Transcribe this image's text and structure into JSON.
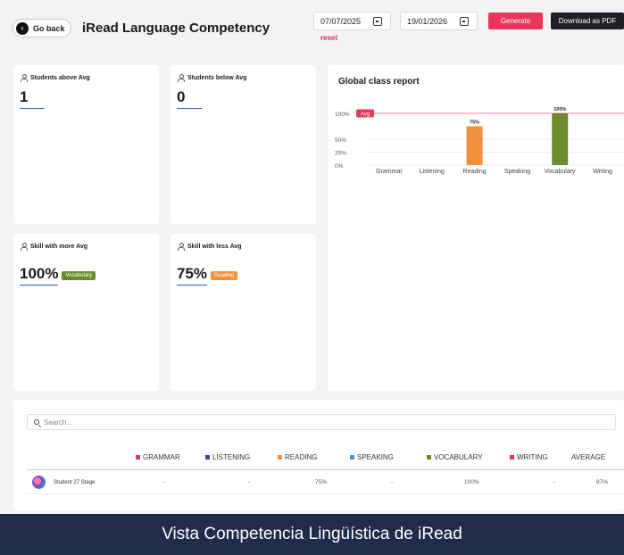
{
  "header": {
    "back_label": "Go back",
    "title": "iRead Language Competency",
    "date_from": "07/07/2025",
    "date_to": "19/01/2026",
    "reset": "reset",
    "generate": "Generate",
    "download": "Download as PDF"
  },
  "cards": {
    "above": {
      "label": "Students above Avg",
      "value": "1"
    },
    "below": {
      "label": "Students below Avg",
      "value": "0"
    },
    "more": {
      "label": "Skill with more Avg",
      "value": "100%",
      "badge": "Vocabulary",
      "color": "#6a8a2c"
    },
    "less": {
      "label": "Skill with less Avg",
      "value": "75%",
      "badge": "Reading",
      "color": "#f0903a"
    }
  },
  "chart": {
    "title": "Global class report",
    "avg_label": "Avg"
  },
  "chart_data": {
    "type": "bar",
    "categories": [
      "Grammar",
      "Listening",
      "Reading",
      "Speaking",
      "Vocabulary",
      "Writing"
    ],
    "values": [
      null,
      null,
      75,
      null,
      100,
      null
    ],
    "data_labels": [
      "",
      "",
      "75%",
      "",
      "100%",
      ""
    ],
    "colors": [
      "#c2407a",
      "#2c4f8f",
      "#f0903a",
      "#4f90d0",
      "#6a8a2c",
      "#d94040"
    ],
    "avg_line": 100,
    "ylim": [
      0,
      100
    ],
    "yticks": [
      {
        "v": 0,
        "label": "0%"
      },
      {
        "v": 25,
        "label": "25%"
      },
      {
        "v": 50,
        "label": "50%"
      },
      {
        "v": 100,
        "label": "100%"
      }
    ],
    "grid": true
  },
  "table": {
    "search_placeholder": "Search...",
    "columns": [
      {
        "label": "GRAMMAR",
        "color": "#c2407a"
      },
      {
        "label": "LISTENING",
        "color": "#2c4f8f"
      },
      {
        "label": "READING",
        "color": "#f0903a"
      },
      {
        "label": "SPEAKING",
        "color": "#4f90d0"
      },
      {
        "label": "VOCABULARY",
        "color": "#6a8a2c"
      },
      {
        "label": "WRITING",
        "color": "#d94040"
      },
      {
        "label": "AVERAGE",
        "color": ""
      }
    ],
    "rows": [
      {
        "name": "Student 27 Stage",
        "cells": [
          "-",
          "-",
          "75%",
          "-",
          "100%",
          "-",
          "87%"
        ]
      }
    ]
  },
  "caption": "Vista Competencia Lingüística de iRead"
}
